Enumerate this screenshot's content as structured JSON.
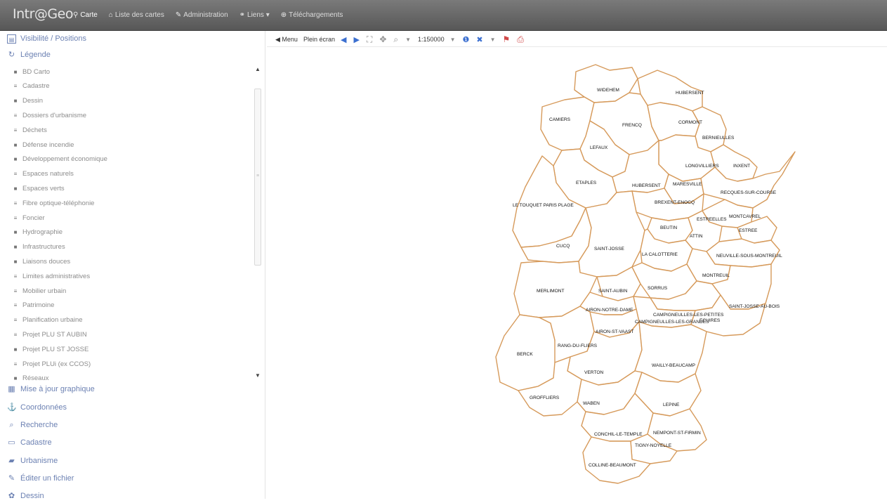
{
  "app": {
    "brand": "Intr@Geo"
  },
  "topnav": [
    {
      "icon": "map-marker-icon",
      "glyph": "⚲",
      "label": "Carte",
      "active": true
    },
    {
      "icon": "home-icon",
      "glyph": "⌂",
      "label": "Liste des cartes"
    },
    {
      "icon": "wrench-icon",
      "glyph": "✎",
      "label": "Administration"
    },
    {
      "icon": "link-icon",
      "glyph": "⚭",
      "label": "Liens ▾"
    },
    {
      "icon": "download-icon",
      "glyph": "⊕",
      "label": "Téléchargements"
    }
  ],
  "sidebar": {
    "visibility_header": "Visibilité / Positions",
    "legend_header": "Légende",
    "layers": [
      "BD Carto",
      "Cadastre",
      "Dessin",
      "Dossiers d'urbanisme",
      "Déchets",
      "Défense incendie",
      "Développement économique",
      "Espaces naturels",
      "Espaces verts",
      "Fibre optique-téléphonie",
      "Foncier",
      "Hydrographie",
      "Infrastructures",
      "Liaisons douces",
      "Limites administratives",
      "Mobilier urbain",
      "Patrimoine",
      "Planification urbaine",
      "Projet PLU ST AUBIN",
      "Projet PLU ST JOSSE",
      "Projet PLUi (ex CCOS)",
      "Réseaux"
    ],
    "panels": [
      {
        "label": "Mise à jour graphique",
        "icon": "pencil-grid-icon",
        "glyph": "▦"
      },
      {
        "label": "Coordonnées",
        "icon": "anchor-icon",
        "glyph": "⚓"
      },
      {
        "label": "Recherche",
        "icon": "search-icon",
        "glyph": "⌕"
      },
      {
        "label": "Cadastre",
        "icon": "map-book-icon",
        "glyph": "▭"
      },
      {
        "label": "Urbanisme",
        "icon": "folder-icon",
        "glyph": "▰"
      },
      {
        "label": "Éditer un fichier",
        "icon": "edit-file-icon",
        "glyph": "✎"
      },
      {
        "label": "Dessin",
        "icon": "draw-icon",
        "glyph": "✿"
      }
    ]
  },
  "toolbar": {
    "menu_label": "◀ Menu",
    "fullscreen_label": "Plein écran",
    "scale": "1:150000"
  },
  "communes": [
    "WIDEHEM",
    "HUBERSENT",
    "CAMIERS",
    "FRENCQ",
    "CORMONT",
    "BERNIEULLES",
    "LEFAUX",
    "LONGVILLIERS",
    "INXENT",
    "ETAPLES",
    "HUBERSENT",
    "MARESVILLE",
    "RECQUES-SUR-COURSE",
    "LE TOUQUET PARIS PLAGE",
    "BREXENT-ENOCQ",
    "MONTCAVREL",
    "ESTREELLES",
    "ESTREE",
    "BEUTIN",
    "ATTIN",
    "CUCQ",
    "SAINT-JOSSE",
    "LA CALOTTERIE",
    "NEUVILLE-SOUS-MONTREUIL",
    "MONTREUIL",
    "MERLIMONT",
    "SAINT-AUBIN",
    "SORRUS",
    "AIRON-NOTRE-DAME",
    "CAMPIGNEULLES-LES-PETITES",
    "SAINT-JOSSE-AU-BOIS",
    "CAMPIGNEULLES-LES-GRANDES",
    "AIRON-ST-VAAST",
    "ECUIRES",
    "BERCK",
    "RANG-DU-FLIERS",
    "VERTON",
    "WAILLY-BEAUCAMP",
    "GROFFLIERS",
    "WABEN",
    "LEPINE",
    "CONCHIL-LE-TEMPLE",
    "NEMPONT-ST-FIRMIN",
    "TIGNY-NOYELLE",
    "COLLINE-BEAUMONT"
  ]
}
